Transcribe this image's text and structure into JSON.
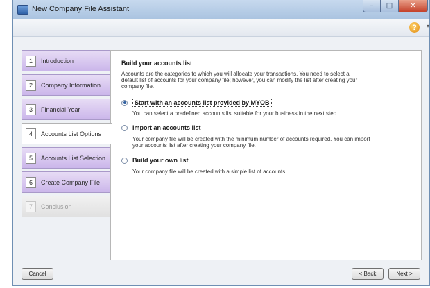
{
  "window": {
    "title": "New Company File Assistant",
    "minimize_glyph": "–",
    "maximize_glyph": "□",
    "close_glyph": "✕"
  },
  "toolbar": {
    "help_icon": "help-icon",
    "help_glyph": "?",
    "help_arrow": "▾"
  },
  "steps": [
    {
      "num": "1",
      "label": "Introduction",
      "state": "done"
    },
    {
      "num": "2",
      "label": "Company Information",
      "state": "done"
    },
    {
      "num": "3",
      "label": "Financial Year",
      "state": "done"
    },
    {
      "num": "4",
      "label": "Accounts List Options",
      "state": "active"
    },
    {
      "num": "5",
      "label": "Accounts List Selection",
      "state": "pending"
    },
    {
      "num": "6",
      "label": "Create Company File",
      "state": "pending"
    },
    {
      "num": "7",
      "label": "Conclusion",
      "state": "disabled"
    }
  ],
  "content": {
    "title": "Build your accounts list",
    "intro": "Accounts are the categories to which you will allocate your transactions. You need to select a default list of accounts for your company file; however, you can modify the list after creating your company file.",
    "options": [
      {
        "label": "Start with an accounts list provided by MYOB",
        "desc": "You can select a predefined accounts list suitable for your business in the next step.",
        "checked": true
      },
      {
        "label": "Import an accounts list",
        "desc": "Your company file will be created with the minimum number of accounts required. You can import your accounts list after creating your company file.",
        "checked": false
      },
      {
        "label": "Build your own list",
        "desc": "Your company file will be created with a simple list of accounts.",
        "checked": false
      }
    ]
  },
  "buttons": {
    "cancel": "Cancel",
    "back": "< Back",
    "next": "Next >"
  },
  "colors": {
    "step_bg": "#cbb6ea",
    "accent": "#2f5fa0",
    "close_red": "#c4412a"
  }
}
